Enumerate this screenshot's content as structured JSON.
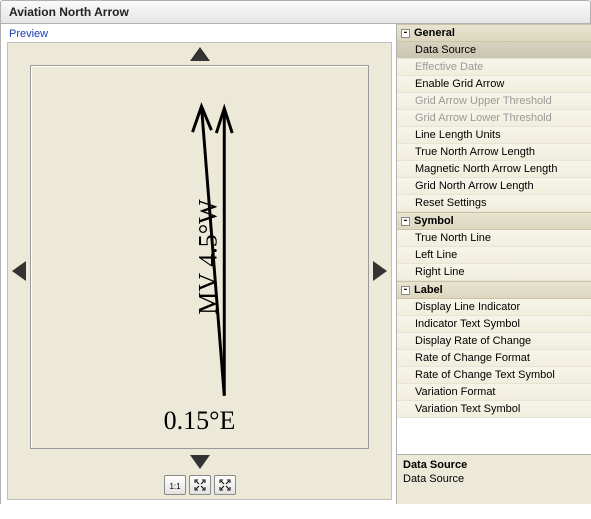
{
  "window": {
    "title": "Aviation North Arrow"
  },
  "preview": {
    "heading": "Preview",
    "side_label": "MV 4.5°W",
    "bottom_label": "0.15°E"
  },
  "zoom": {
    "btn1": "1:1",
    "btn2": "fit",
    "btn3": "full"
  },
  "groups": [
    {
      "name": "General",
      "items": [
        {
          "label": "Data Source",
          "selected": true
        },
        {
          "label": "Effective Date",
          "disabled": true
        },
        {
          "label": "Enable Grid Arrow"
        },
        {
          "label": "Grid Arrow Upper Threshold",
          "disabled": true
        },
        {
          "label": "Grid Arrow Lower Threshold",
          "disabled": true
        },
        {
          "label": "Line Length Units"
        },
        {
          "label": "True North Arrow Length"
        },
        {
          "label": "Magnetic North Arrow Length"
        },
        {
          "label": "Grid North Arrow Length"
        },
        {
          "label": "Reset Settings"
        }
      ]
    },
    {
      "name": "Symbol",
      "items": [
        {
          "label": "True North Line"
        },
        {
          "label": "Left Line"
        },
        {
          "label": "Right Line"
        }
      ]
    },
    {
      "name": "Label",
      "items": [
        {
          "label": "Display Line Indicator"
        },
        {
          "label": "Indicator Text Symbol"
        },
        {
          "label": "Display Rate of Change"
        },
        {
          "label": "Rate of Change Format"
        },
        {
          "label": "Rate of Change Text Symbol"
        },
        {
          "label": "Variation Format"
        },
        {
          "label": "Variation Text Symbol"
        }
      ]
    }
  ],
  "description": {
    "title": "Data Source",
    "text": "Data Source"
  }
}
